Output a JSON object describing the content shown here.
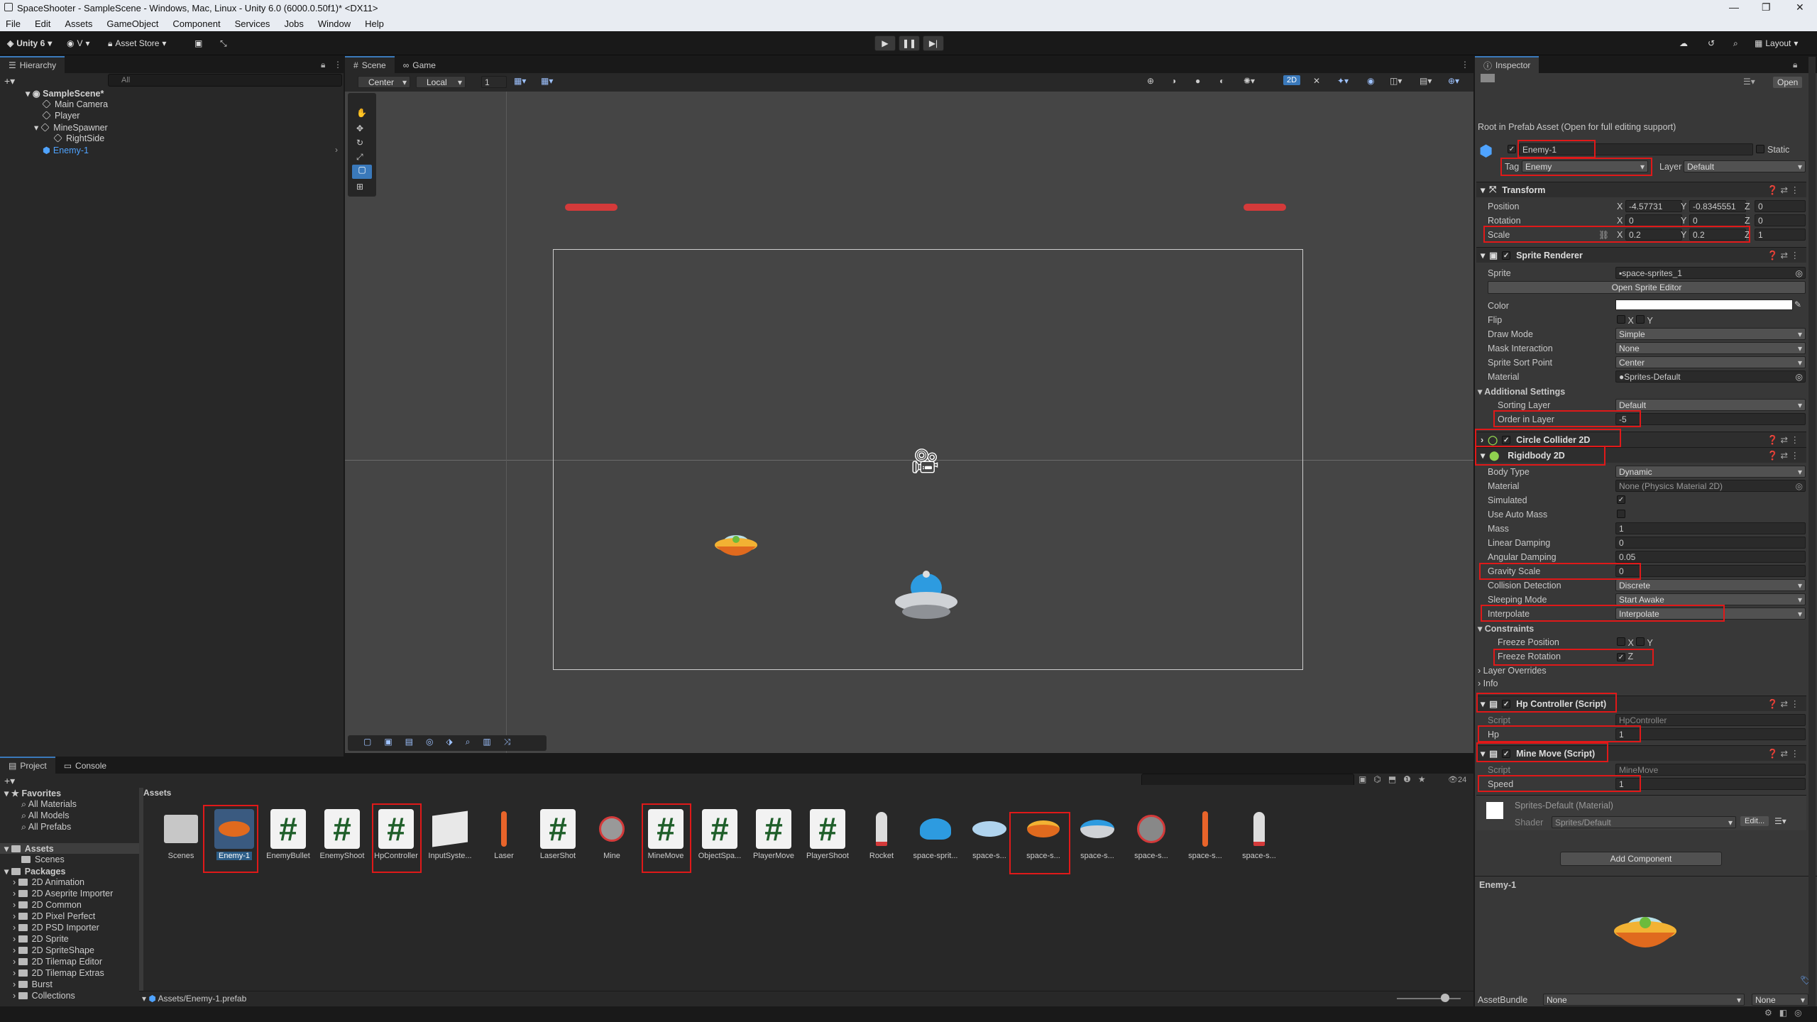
{
  "window": {
    "title": "SpaceShooter - SampleScene - Windows, Mac, Linux - Unity 6.0 (6000.0.50f1)* <DX11>"
  },
  "menu": [
    "File",
    "Edit",
    "Assets",
    "GameObject",
    "Component",
    "Services",
    "Jobs",
    "Window",
    "Help"
  ],
  "toolbar": {
    "account": "Unity 6",
    "version_ctrl": "V",
    "asset_store": "Asset Store",
    "layout": "Layout"
  },
  "hierarchy": {
    "tab": "Hierarchy",
    "search_placeholder": "All",
    "items": [
      {
        "label": "SampleScene*"
      },
      {
        "label": "Main Camera"
      },
      {
        "label": "Player"
      },
      {
        "label": "MineSpawner"
      },
      {
        "label": "RightSide"
      },
      {
        "label": "Enemy-1"
      }
    ]
  },
  "scene": {
    "tabs": [
      "Scene",
      "Game"
    ],
    "pivot": "Center",
    "space": "Local",
    "snap": "1",
    "mode2d": "2D"
  },
  "project": {
    "tabs": [
      "Project",
      "Console"
    ],
    "badge": "24",
    "favorites": {
      "label": "Favorites",
      "items": [
        "All Materials",
        "All Models",
        "All Prefabs"
      ]
    },
    "assets_root": "Assets",
    "scenes": "Scenes",
    "packages": {
      "label": "Packages",
      "items": [
        "2D Animation",
        "2D Aseprite Importer",
        "2D Common",
        "2D Pixel Perfect",
        "2D PSD Importer",
        "2D Sprite",
        "2D SpriteShape",
        "2D Tilemap Editor",
        "2D Tilemap Extras",
        "Burst",
        "Collections"
      ]
    },
    "breadcrumb": "Assets",
    "assets": [
      "Scenes",
      "Enemy-1",
      "EnemyBullet",
      "EnemyShoot",
      "HpController",
      "InputSyste...",
      "Laser",
      "LaserShot",
      "Mine",
      "MineMove",
      "ObjectSpa...",
      "PlayerMove",
      "PlayerShoot",
      "Rocket",
      "space-sprit...",
      "space-s...",
      "space-s...",
      "space-s...",
      "space-s...",
      "space-s...",
      "space-s..."
    ],
    "path": "Assets/Enemy-1.prefab"
  },
  "inspector": {
    "tab": "Inspector",
    "open": "Open",
    "prefab_note": "Root in Prefab Asset (Open for full editing support)",
    "name": "Enemy-1",
    "static": "Static",
    "tag_label": "Tag",
    "tag": "Enemy",
    "layer_label": "Layer",
    "layer": "Default",
    "transform": {
      "title": "Transform",
      "position_label": "Position",
      "px": "-4.57731",
      "py": "-0.8345551",
      "pz": "0",
      "rotation_label": "Rotation",
      "rx": "0",
      "ry": "0",
      "rz": "0",
      "scale_label": "Scale",
      "sx": "0.2",
      "sy": "0.2",
      "sz": "1"
    },
    "sprite_renderer": {
      "title": "Sprite Renderer",
      "sprite_label": "Sprite",
      "sprite": "space-sprites_1",
      "edit_btn": "Open Sprite Editor",
      "color_label": "Color",
      "flip_label": "Flip",
      "draw_mode_label": "Draw Mode",
      "draw_mode": "Simple",
      "mask_label": "Mask Interaction",
      "mask": "None",
      "sort_point_label": "Sprite Sort Point",
      "sort_point": "Center",
      "material_label": "Material",
      "material": "Sprites-Default",
      "additional": "Additional Settings",
      "sorting_layer_label": "Sorting Layer",
      "sorting_layer": "Default",
      "order_label": "Order in Layer",
      "order": "-5"
    },
    "circle_collider": "Circle Collider 2D",
    "rigidbody": {
      "title": "Rigidbody 2D",
      "body_type_label": "Body Type",
      "body_type": "Dynamic",
      "material_label": "Material",
      "material": "None (Physics Material 2D)",
      "simulated_label": "Simulated",
      "auto_mass_label": "Use Auto Mass",
      "mass_label": "Mass",
      "mass": "1",
      "lin_damp_label": "Linear Damping",
      "lin_damp": "0",
      "ang_damp_label": "Angular Damping",
      "ang_damp": "0.05",
      "gravity_label": "Gravity Scale",
      "gravity": "0",
      "collision_label": "Collision Detection",
      "collision": "Discrete",
      "sleep_label": "Sleeping Mode",
      "sleep": "Start Awake",
      "interp_label": "Interpolate",
      "interp": "Interpolate",
      "constraints": "Constraints",
      "freeze_pos": "Freeze Position",
      "freeze_rot": "Freeze Rotation",
      "layer_overrides": "Layer Overrides",
      "info": "Info"
    },
    "hp": {
      "title": "Hp Controller (Script)",
      "script_label": "Script",
      "script": "HpController",
      "hp_label": "Hp",
      "hp": "1"
    },
    "mine": {
      "title": "Mine Move (Script)",
      "script_label": "Script",
      "script": "MineMove",
      "speed_label": "Speed",
      "speed": "1"
    },
    "material": {
      "title": "Sprites-Default (Material)",
      "shader_label": "Shader",
      "shader": "Sprites/Default",
      "edit": "Edit..."
    },
    "add_component": "Add Component",
    "preview_title": "Enemy-1",
    "assetbundle_label": "AssetBundle",
    "assetbundle": "None",
    "assetbundle_variant": "None"
  }
}
